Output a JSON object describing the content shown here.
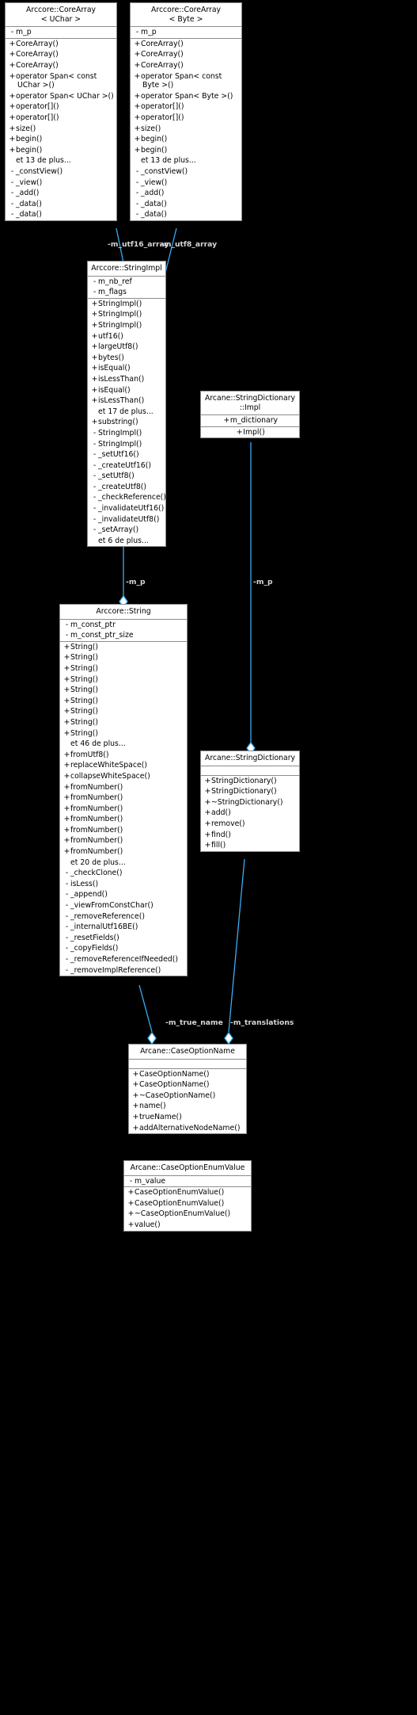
{
  "diagram": {
    "type": "uml-collaboration-diagram",
    "background_color": "#000000",
    "node_fill": "#ffffff",
    "node_border": "#8c8c8c",
    "edge_color": "#3badf2",
    "edge_label_color": "#d8d8d8",
    "more_text_13": "et 13 de plus...",
    "more_text_17": "et 17 de plus...",
    "more_text_6": "et 6 de plus...",
    "more_text_46": "et 46 de plus...",
    "more_text_20": "et 20 de plus..."
  },
  "nodes": {
    "corearray_uchar": {
      "title_line1": "Arccore::CoreArray",
      "title_line2": "< UChar >",
      "attributes": [
        {
          "vis": "-",
          "name": "m_p"
        }
      ],
      "methods": [
        {
          "vis": "+",
          "name": "CoreArray()"
        },
        {
          "vis": "+",
          "name": "CoreArray()"
        },
        {
          "vis": "+",
          "name": "CoreArray()"
        },
        {
          "vis": "+",
          "name": "operator Span< const",
          "cont": "UChar >()"
        },
        {
          "vis": "+",
          "name": "operator Span< UChar >()"
        },
        {
          "vis": "+",
          "name": "operator[]()"
        },
        {
          "vis": "+",
          "name": "operator[]()"
        },
        {
          "vis": "+",
          "name": "size()"
        },
        {
          "vis": "+",
          "name": "begin()"
        },
        {
          "vis": "+",
          "name": "begin()"
        },
        {
          "vis": " ",
          "name": "et 13 de plus...",
          "more": true
        },
        {
          "vis": "-",
          "name": "_constView()"
        },
        {
          "vis": "-",
          "name": "_view()"
        },
        {
          "vis": "-",
          "name": "_add()"
        },
        {
          "vis": "-",
          "name": "_data()"
        },
        {
          "vis": "-",
          "name": "_data()"
        }
      ]
    },
    "corearray_byte": {
      "title_line1": "Arccore::CoreArray",
      "title_line2": "< Byte >",
      "attributes": [
        {
          "vis": "-",
          "name": "m_p"
        }
      ],
      "methods": [
        {
          "vis": "+",
          "name": "CoreArray()"
        },
        {
          "vis": "+",
          "name": "CoreArray()"
        },
        {
          "vis": "+",
          "name": "CoreArray()"
        },
        {
          "vis": "+",
          "name": "operator Span< const",
          "cont": "Byte >()"
        },
        {
          "vis": "+",
          "name": "operator Span< Byte >()"
        },
        {
          "vis": "+",
          "name": "operator[]()"
        },
        {
          "vis": "+",
          "name": "operator[]()"
        },
        {
          "vis": "+",
          "name": "size()"
        },
        {
          "vis": "+",
          "name": "begin()"
        },
        {
          "vis": "+",
          "name": "begin()"
        },
        {
          "vis": " ",
          "name": "et 13 de plus...",
          "more": true
        },
        {
          "vis": "-",
          "name": "_constView()"
        },
        {
          "vis": "-",
          "name": "_view()"
        },
        {
          "vis": "-",
          "name": "_add()"
        },
        {
          "vis": "-",
          "name": "_data()"
        },
        {
          "vis": "-",
          "name": "_data()"
        }
      ]
    },
    "stringimpl": {
      "title_line1": "Arccore::StringImpl",
      "title_line2": "",
      "attributes": [
        {
          "vis": "-",
          "name": "m_nb_ref"
        },
        {
          "vis": "-",
          "name": "m_flags"
        }
      ],
      "methods": [
        {
          "vis": "+",
          "name": "StringImpl()"
        },
        {
          "vis": "+",
          "name": "StringImpl()"
        },
        {
          "vis": "+",
          "name": "StringImpl()"
        },
        {
          "vis": "+",
          "name": "utf16()"
        },
        {
          "vis": "+",
          "name": "largeUtf8()"
        },
        {
          "vis": "+",
          "name": "bytes()"
        },
        {
          "vis": "+",
          "name": "isEqual()"
        },
        {
          "vis": "+",
          "name": "isLessThan()"
        },
        {
          "vis": "+",
          "name": "isEqual()"
        },
        {
          "vis": "+",
          "name": "isLessThan()"
        },
        {
          "vis": " ",
          "name": "et 17 de plus...",
          "more": true
        },
        {
          "vis": "+",
          "name": "substring()"
        },
        {
          "vis": "-",
          "name": "StringImpl()"
        },
        {
          "vis": "-",
          "name": "StringImpl()"
        },
        {
          "vis": "-",
          "name": "_setUtf16()"
        },
        {
          "vis": "-",
          "name": "_createUtf16()"
        },
        {
          "vis": "-",
          "name": "_setUtf8()"
        },
        {
          "vis": "-",
          "name": "_createUtf8()"
        },
        {
          "vis": "-",
          "name": "_checkReference()"
        },
        {
          "vis": "-",
          "name": "_invalidateUtf16()"
        },
        {
          "vis": "-",
          "name": "_invalidateUtf8()"
        },
        {
          "vis": "-",
          "name": "_setArray()"
        },
        {
          "vis": " ",
          "name": "et 6 de plus...",
          "more": true
        }
      ]
    },
    "stringdictionary_impl": {
      "title_line1": "Arcane::StringDictionary",
      "title_line2": "::Impl",
      "attributes": [
        {
          "vis": "+",
          "name": "m_dictionary"
        }
      ],
      "methods": [
        {
          "vis": "+",
          "name": "Impl()"
        }
      ]
    },
    "string": {
      "title_line1": "Arccore::String",
      "title_line2": "",
      "attributes": [
        {
          "vis": "-",
          "name": "m_const_ptr"
        },
        {
          "vis": "-",
          "name": "m_const_ptr_size"
        }
      ],
      "methods": [
        {
          "vis": "+",
          "name": "String()"
        },
        {
          "vis": "+",
          "name": "String()"
        },
        {
          "vis": "+",
          "name": "String()"
        },
        {
          "vis": "+",
          "name": "String()"
        },
        {
          "vis": "+",
          "name": "String()"
        },
        {
          "vis": "+",
          "name": "String()"
        },
        {
          "vis": "+",
          "name": "String()"
        },
        {
          "vis": "+",
          "name": "String()"
        },
        {
          "vis": "+",
          "name": "String()"
        },
        {
          "vis": " ",
          "name": "et 46 de plus...",
          "more": true
        },
        {
          "vis": "+",
          "name": "fromUtf8()"
        },
        {
          "vis": "+",
          "name": "replaceWhiteSpace()"
        },
        {
          "vis": "+",
          "name": "collapseWhiteSpace()"
        },
        {
          "vis": "+",
          "name": "fromNumber()"
        },
        {
          "vis": "+",
          "name": "fromNumber()"
        },
        {
          "vis": "+",
          "name": "fromNumber()"
        },
        {
          "vis": "+",
          "name": "fromNumber()"
        },
        {
          "vis": "+",
          "name": "fromNumber()"
        },
        {
          "vis": "+",
          "name": "fromNumber()"
        },
        {
          "vis": "+",
          "name": "fromNumber()"
        },
        {
          "vis": " ",
          "name": "et 20 de plus...",
          "more": true
        },
        {
          "vis": "-",
          "name": "_checkClone()"
        },
        {
          "vis": "-",
          "name": "isLess()"
        },
        {
          "vis": "-",
          "name": "_append()"
        },
        {
          "vis": "-",
          "name": "_viewFromConstChar()"
        },
        {
          "vis": "-",
          "name": "_removeReference()"
        },
        {
          "vis": "-",
          "name": "_internalUtf16BE()"
        },
        {
          "vis": "-",
          "name": "_resetFields()"
        },
        {
          "vis": "-",
          "name": "_copyFields()"
        },
        {
          "vis": "-",
          "name": "_removeReferenceIfNeeded()"
        },
        {
          "vis": "-",
          "name": "_removeImplReference()"
        }
      ]
    },
    "stringdictionary": {
      "title_line1": "Arcane::StringDictionary",
      "title_line2": "",
      "attributes": [],
      "methods": [
        {
          "vis": "+",
          "name": "StringDictionary()"
        },
        {
          "vis": "+",
          "name": "StringDictionary()"
        },
        {
          "vis": "+",
          "name": "~StringDictionary()"
        },
        {
          "vis": "+",
          "name": "add()"
        },
        {
          "vis": "+",
          "name": "remove()"
        },
        {
          "vis": "+",
          "name": "find()"
        },
        {
          "vis": "+",
          "name": "fill()"
        }
      ]
    },
    "caseoptionname": {
      "title_line1": "Arcane::CaseOptionName",
      "title_line2": "",
      "attributes": [],
      "methods": [
        {
          "vis": "+",
          "name": "CaseOptionName()"
        },
        {
          "vis": "+",
          "name": "CaseOptionName()"
        },
        {
          "vis": "+",
          "name": "~CaseOptionName()"
        },
        {
          "vis": "+",
          "name": "name()"
        },
        {
          "vis": "+",
          "name": "trueName()"
        },
        {
          "vis": "+",
          "name": "addAlternativeNodeName()"
        }
      ]
    },
    "caseoptionenumvalue": {
      "title_line1": "Arcane::CaseOptionEnumValue",
      "title_line2": "",
      "attributes": [
        {
          "vis": "-",
          "name": "m_value"
        }
      ],
      "methods": [
        {
          "vis": "+",
          "name": "CaseOptionEnumValue()"
        },
        {
          "vis": "+",
          "name": "CaseOptionEnumValue()"
        },
        {
          "vis": "+",
          "name": "~CaseOptionEnumValue()"
        },
        {
          "vis": "+",
          "name": "value()"
        }
      ]
    }
  },
  "edge_labels": {
    "m_utf16_array": "-m_utf16_array",
    "m_utf8_array": "-m_utf8_array",
    "m_p_string": "-m_p",
    "m_p_dict": "-m_p",
    "m_true_name": "-m_true_name",
    "m_translations": "-m_translations"
  }
}
